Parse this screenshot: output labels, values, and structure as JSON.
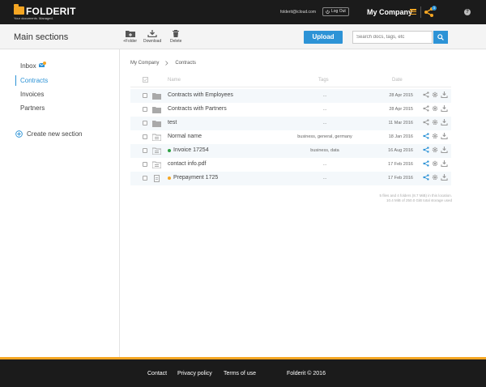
{
  "topbar": {
    "brand": "FOLDERIT",
    "tagline": "Your documents. Managed.",
    "email": "folderit@icloud.com",
    "logout_label": "Log Out",
    "company": "My Company",
    "notification_count": "3",
    "help": "?",
    "accent": "#f5a623"
  },
  "toolbar": {
    "title": "Main sections",
    "new_folder_label": "+Folder",
    "download_label": "Download",
    "delete_label": "Delete",
    "upload_label": "Upload",
    "search_placeholder": "Search docs, tags, etc",
    "primary_color": "#2d93d6"
  },
  "sidebar": {
    "items": [
      {
        "label": "Inbox"
      },
      {
        "label": "Contracts"
      },
      {
        "label": "Invoices"
      },
      {
        "label": "Partners"
      }
    ],
    "create_label": "Create new section"
  },
  "breadcrumb": {
    "items": [
      "My Company",
      "Contracts"
    ]
  },
  "table": {
    "headers": {
      "name": "Name",
      "tags": "Tags",
      "date": "Date"
    },
    "rows": [
      {
        "name": "Contracts with Employees",
        "tags": "...",
        "date": "28 Apr 2015",
        "type": "folder"
      },
      {
        "name": "Contracts with Partners",
        "tags": "...",
        "date": "28 Apr 2015",
        "type": "folder"
      },
      {
        "name": "test",
        "tags": "...",
        "date": "11 Mar 2016",
        "type": "folder"
      },
      {
        "name": "Normal name",
        "tags": "business, general, germany",
        "date": "18 Jan 2016",
        "type": "doc"
      },
      {
        "name": "Invoice 17254",
        "tags": "business, data",
        "date": "16 Aug 2016",
        "type": "doc",
        "status_color": "#2ea043"
      },
      {
        "name": "contact info.pdf",
        "tags": "...",
        "date": "17 Feb 2016",
        "type": "doc"
      },
      {
        "name": "Prepayment 1725",
        "tags": "...",
        "date": "17 Feb 2016",
        "type": "file",
        "status_color": "#f5a623"
      }
    ]
  },
  "storage": {
    "line1": "5 files and 4 folders (8.7 MiB) in this location.",
    "line2": "10.4 MiB of 250.0 GiB total storage used"
  },
  "footer": {
    "contact": "Contact",
    "privacy": "Privacy policy",
    "terms": "Terms of use",
    "copyright": "Folderit © 2016"
  }
}
